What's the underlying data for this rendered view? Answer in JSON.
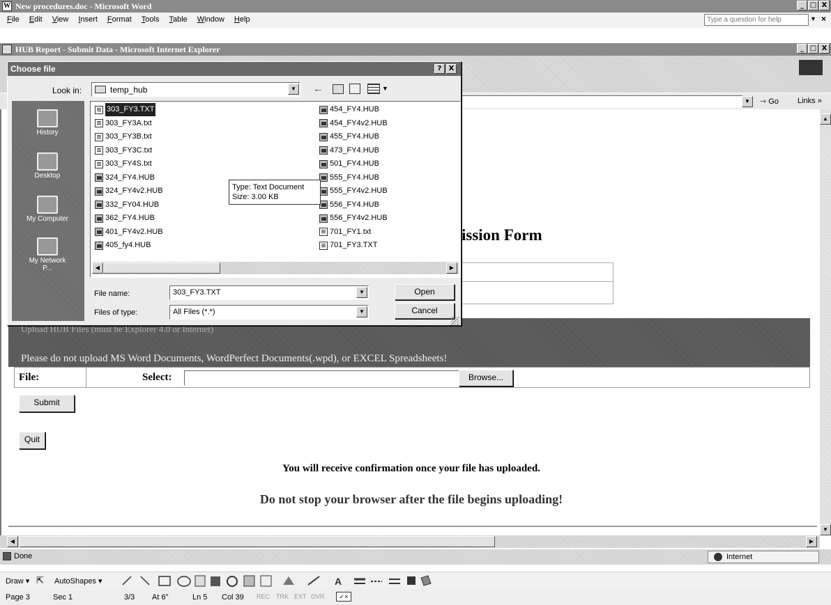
{
  "word": {
    "title": "New procedures.doc - Microsoft Word",
    "menu": [
      "File",
      "Edit",
      "View",
      "Insert",
      "Format",
      "Tools",
      "Table",
      "Window",
      "Help"
    ],
    "help_placeholder": "Type a question for help",
    "window_buttons": [
      "_",
      "□",
      "X"
    ],
    "drawing_toolbar": {
      "draw": "Draw ▾",
      "autoshapes": "AutoShapes ▾"
    },
    "status": {
      "page": "Page 3",
      "sec": "Sec 1",
      "pages": "3/3",
      "at": "At 6\"",
      "ln": "Ln 5",
      "col": "Col 39",
      "rec": "REC",
      "trk": "TRK",
      "ext": "EXT",
      "ovr": "OVR"
    }
  },
  "ie": {
    "title": "HUB Report - Submit Data - Microsoft Internet Explorer",
    "go_label": "Go",
    "links_label": "Links »",
    "status_text": "Done",
    "zone": "Internet"
  },
  "page": {
    "form_title": "ission Form",
    "dark_band_partial": "Upload HUB Files (must be Explorer 4.0 or Internet)",
    "warning": "Please do not upload MS Word Documents, WordPerfect Documents(.wpd), or EXCEL Spreadsheets!",
    "file_label": "File:",
    "select_label": "Select:",
    "browse_button": "Browse...",
    "submit_button": "Submit",
    "quit_button": "Quit",
    "confirmation": "You will receive confirmation once your file has uploaded.",
    "do_not_stop": "Do not stop your browser after the file begins uploading!"
  },
  "dialog": {
    "title": "Choose file",
    "help_btn": "?",
    "close_btn": "X",
    "look_in_label": "Look in:",
    "look_in_value": "temp_hub",
    "places": [
      "History",
      "Desktop",
      "My Computer",
      "My Network P..."
    ],
    "files_col1": [
      {
        "name": "303_FY3.TXT",
        "kind": "txt"
      },
      {
        "name": "303_FY3A.txt",
        "kind": "txt"
      },
      {
        "name": "303_FY3B.txt",
        "kind": "txt"
      },
      {
        "name": "303_FY3C.txt",
        "kind": "txt"
      },
      {
        "name": "303_FY4S.txt",
        "kind": "txt"
      },
      {
        "name": "324_FY4.HUB",
        "kind": "hub"
      },
      {
        "name": "324_FY4v2.HUB",
        "kind": "hub"
      },
      {
        "name": "332_FY04.HUB",
        "kind": "hub"
      },
      {
        "name": "362_FY4.HUB",
        "kind": "hub"
      },
      {
        "name": "401_FY4v2.HUB",
        "kind": "hub"
      },
      {
        "name": "405_fy4.HUB",
        "kind": "hub"
      }
    ],
    "files_col2": [
      {
        "name": "454_FY4.HUB",
        "kind": "hub"
      },
      {
        "name": "454_FY4v2.HUB",
        "kind": "hub"
      },
      {
        "name": "455_FY4.HUB",
        "kind": "hub"
      },
      {
        "name": "473_FY4.HUB",
        "kind": "hub"
      },
      {
        "name": "501_FY4.HUB",
        "kind": "hub"
      },
      {
        "name": "555_FY4.HUB",
        "kind": "hub"
      },
      {
        "name": "555_FY4v2.HUB",
        "kind": "hub"
      },
      {
        "name": "556_FY4.HUB",
        "kind": "hub"
      },
      {
        "name": "556_FY4v2.HUB",
        "kind": "hub"
      },
      {
        "name": "701_FY1.txt",
        "kind": "txt"
      },
      {
        "name": "701_FY3.TXT",
        "kind": "txt"
      }
    ],
    "tooltip_type": "Type: Text Document",
    "tooltip_size": "Size: 3.00 KB",
    "file_name_label": "File name:",
    "file_name_value": "303_FY3.TXT",
    "files_of_type_label": "Files of type:",
    "files_of_type_value": "All Files (*.*)",
    "open_button": "Open",
    "cancel_button": "Cancel"
  },
  "colors": {
    "titlebar": "#8a8a8a",
    "dark_band": "#555555",
    "selection": "#222222"
  }
}
